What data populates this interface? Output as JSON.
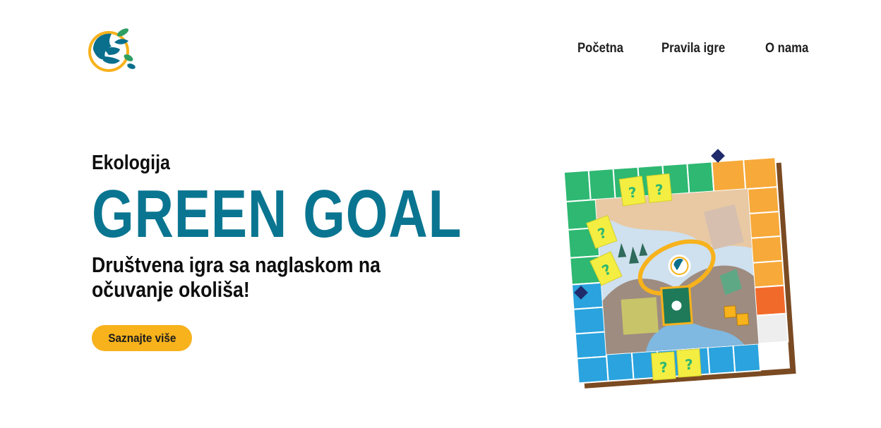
{
  "nav": {
    "items": [
      "Početna",
      "Pravila igre",
      "O nama"
    ]
  },
  "hero": {
    "eyebrow": "Ekologija",
    "title": "GREEN GOAL",
    "subtitle": "Društvena igra sa naglaskom na očuvanje okoliša!",
    "cta_label": "Saznajte više"
  },
  "board": {
    "card_glyph": "?"
  },
  "colors": {
    "brand_teal": "#0a7590",
    "accent_yellow": "#f7b21c",
    "board_green": "#2eb872",
    "board_orange": "#f7a93a",
    "board_blue": "#2aa3de"
  },
  "icons": [
    "logo-hand-leaves-icon",
    "board-game-illustration"
  ]
}
